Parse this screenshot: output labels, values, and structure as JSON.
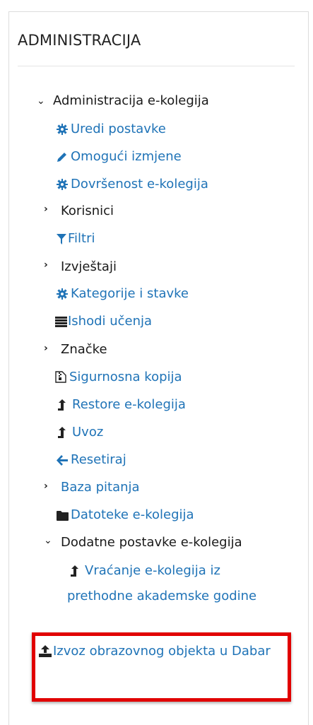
{
  "block": {
    "title": "ADMINISTRACIJA"
  },
  "menu": {
    "course_admin": "Administracija e-kolegija",
    "edit_settings": "Uredi postavke",
    "turn_editing_on": "Omogući izmjene",
    "course_completion": "Dovršenost e-kolegija",
    "users": "Korisnici",
    "filters": "Filtri",
    "reports": "Izvještaji",
    "gradebook_setup": "Kategorije i stavke",
    "outcomes": "Ishodi učenja",
    "badges": "Značke",
    "backup": "Sigurnosna kopija",
    "restore": "Restore e-kolegija",
    "import": "Uvoz",
    "reset": "Resetiraj",
    "question_bank": "Baza pitanja",
    "course_files": "Datoteke e-kolegija",
    "additional_settings": "Dodatne postavke e-kolegija",
    "restore_previous_year": "Vraćanje e-kolegija iz prethodne akademske godine",
    "export_to_dabar": "Izvoz obrazovnog objekta u Dabar"
  },
  "colors": {
    "link": "#1f73b7",
    "text": "#1a1a1a",
    "highlight": "#e10000"
  }
}
